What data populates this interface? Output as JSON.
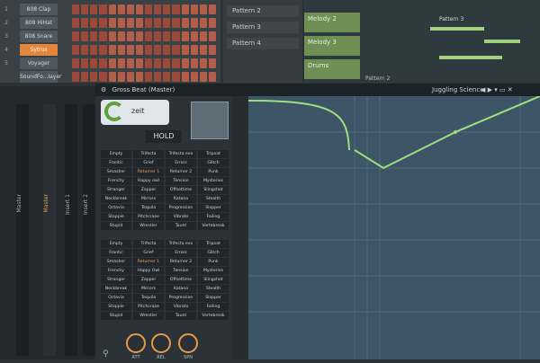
{
  "channel_rack": {
    "channels": [
      {
        "num": "1",
        "label": "808 Clap"
      },
      {
        "num": "2",
        "label": "808 HiHat"
      },
      {
        "num": "3",
        "label": "808 Snare"
      },
      {
        "num": "4",
        "label": "Sytrus"
      },
      {
        "num": "5",
        "label": "Voyager"
      },
      {
        "num": "",
        "label": "SoundFo...layer"
      }
    ],
    "selected_index": 3
  },
  "pattern_list": [
    "Pattern 2",
    "Pattern 3",
    "Pattern 4"
  ],
  "playlist": {
    "tracks": [
      "Melody 2",
      "Melody 3",
      "Drums"
    ],
    "clip_label": "Pattern 3",
    "bottom_clip": "Pattern 2"
  },
  "mixer": {
    "strips": [
      "Master",
      "Insert 1",
      "Insert 2"
    ]
  },
  "gross_beat": {
    "title": "Gross Beat (Master)",
    "preset_header": "Juggling Science",
    "logo": "zeit",
    "hold": "HOLD",
    "knobs": [
      "ATT",
      "REL",
      "SPN"
    ],
    "grid_top": [
      "Empty",
      "Trifecta",
      "Trifecta evo",
      "Tripoat",
      "Frantic",
      "Grief",
      "Errors",
      "Glitch",
      "Smasher",
      "Returner 1",
      "Returner 2",
      "Punk",
      "Frenchy",
      "Happy owl",
      "Tension",
      "Mysteries",
      "Stranger",
      "Zapper",
      "Offsettime",
      "Slingshot",
      "Neckbreak",
      "Mirrors",
      "Katana",
      "Stealth",
      "Octavia",
      "Tequila",
      "Progression",
      "Slapper",
      "Stoppie",
      "Pitchcraze",
      "Vibrato",
      "Failing",
      "Stupid",
      "Wrestler",
      "Taunt",
      "Vertebreak"
    ],
    "grid_bottom": [
      "Empty",
      "Trifecta",
      "Trifecta evo",
      "Tripoat",
      "Frantic",
      "Grief",
      "Errors",
      "Glitch",
      "Smasher",
      "Returner 1",
      "Returner 2",
      "Punk",
      "Frenchy",
      "Happy Owl",
      "Tension",
      "Mysteries",
      "Stranger",
      "Zapper",
      "Offsettime",
      "Slingshot",
      "Neckbreak",
      "Mirrors",
      "Katana",
      "Stealth",
      "Octavia",
      "Tequila",
      "Progression",
      "Slapper",
      "Stoppie",
      "Pitchcraze",
      "Vibrato",
      "Failing",
      "Stupid",
      "Wrestler",
      "Taunt",
      "Vertebreak"
    ],
    "highlight_index": 9
  }
}
